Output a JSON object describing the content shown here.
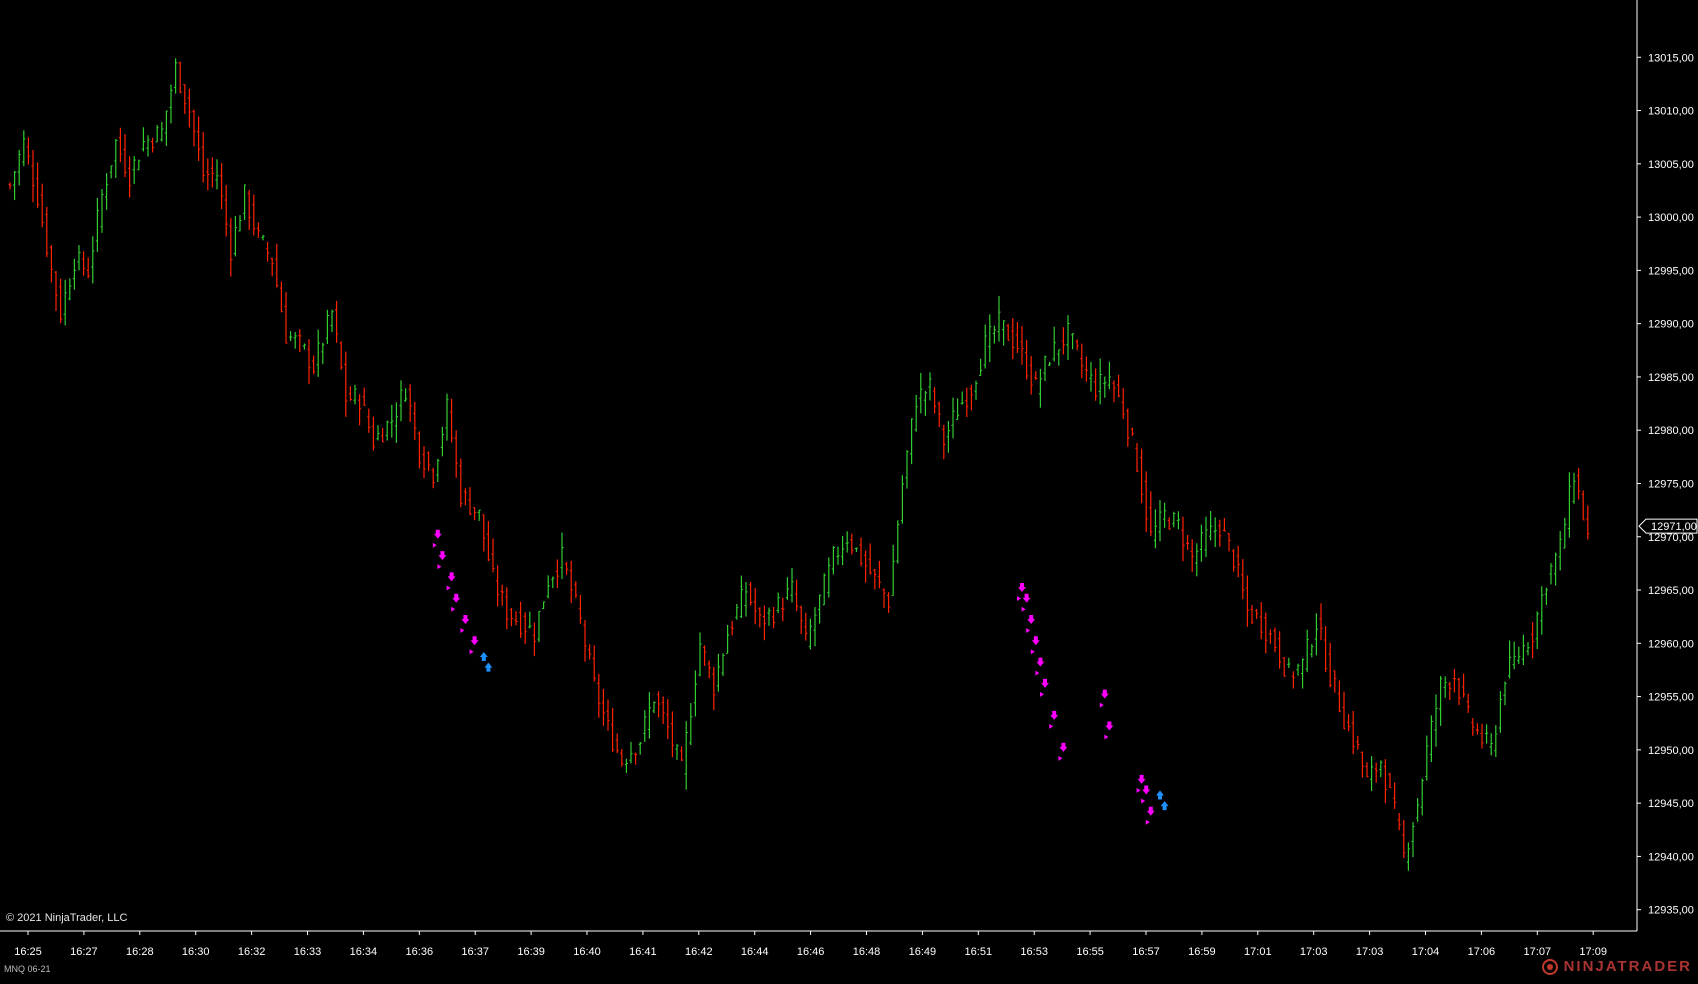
{
  "instrument": "MNQ 06-21",
  "copyright": "© 2021 NinjaTrader, LLC",
  "brand": "NINJATRADER",
  "colors": {
    "background": "#000000",
    "up": "#32cd32",
    "down": "#ff2200",
    "marker_sell": "#ff00ff",
    "marker_buy": "#1e90ff",
    "axis": "#ffffff"
  },
  "chart_data": {
    "type": "ohlc",
    "price_axis": {
      "ylim": [
        12933,
        13020
      ],
      "ticks": [
        "13015,00",
        "13010,00",
        "13005,00",
        "13000,00",
        "12995,00",
        "12990,00",
        "12985,00",
        "12980,00",
        "12975,00",
        "12970,00",
        "12965,00",
        "12960,00",
        "12955,00",
        "12950,00",
        "12945,00",
        "12940,00",
        "12935,00"
      ],
      "tick_values": [
        13015,
        13010,
        13005,
        13000,
        12995,
        12990,
        12985,
        12980,
        12975,
        12970,
        12965,
        12960,
        12955,
        12950,
        12945,
        12940,
        12935
      ],
      "last_price_label": "12971,00",
      "last_price": 12971
    },
    "time_axis": {
      "labels": [
        "16:25",
        "16:27",
        "16:28",
        "16:30",
        "16:32",
        "16:33",
        "16:34",
        "16:36",
        "16:37",
        "16:39",
        "16:40",
        "16:41",
        "16:42",
        "16:44",
        "16:46",
        "16:48",
        "16:49",
        "16:51",
        "16:53",
        "16:55",
        "16:57",
        "16:59",
        "17:01",
        "17:03",
        "17:03",
        "17:04",
        "17:06",
        "17:07",
        "17:09"
      ]
    },
    "path": [
      [
        0,
        13003
      ],
      [
        3,
        13007
      ],
      [
        6,
        13002
      ],
      [
        9,
        12995
      ],
      [
        11,
        12991
      ],
      [
        14,
        12996
      ],
      [
        17,
        12995
      ],
      [
        20,
        13002
      ],
      [
        23,
        13007
      ],
      [
        26,
        13004
      ],
      [
        29,
        13007
      ],
      [
        33,
        13008
      ],
      [
        36,
        13014
      ],
      [
        39,
        13010
      ],
      [
        42,
        13004
      ],
      [
        45,
        13004
      ],
      [
        48,
        12997
      ],
      [
        51,
        13002
      ],
      [
        54,
        12998
      ],
      [
        57,
        12996
      ],
      [
        60,
        12989
      ],
      [
        63,
        12988
      ],
      [
        66,
        12986
      ],
      [
        70,
        12991
      ],
      [
        73,
        12983
      ],
      [
        76,
        12983
      ],
      [
        79,
        12979
      ],
      [
        83,
        12981
      ],
      [
        86,
        12984
      ],
      [
        89,
        12978
      ],
      [
        92,
        12976
      ],
      [
        95,
        12982
      ],
      [
        98,
        12974
      ],
      [
        102,
        12972
      ],
      [
        105,
        12966
      ],
      [
        108,
        12963
      ],
      [
        111,
        12962
      ],
      [
        114,
        12961
      ],
      [
        117,
        12966
      ],
      [
        120,
        12968
      ],
      [
        124,
        12962
      ],
      [
        127,
        12956
      ],
      [
        130,
        12952
      ],
      [
        133,
        12949
      ],
      [
        137,
        12951
      ],
      [
        140,
        12955
      ],
      [
        143,
        12952
      ],
      [
        146,
        12948
      ],
      [
        150,
        12960
      ],
      [
        153,
        12956
      ],
      [
        156,
        12961
      ],
      [
        160,
        12965
      ],
      [
        163,
        12962
      ],
      [
        166,
        12963
      ],
      [
        170,
        12965
      ],
      [
        173,
        12960
      ],
      [
        176,
        12964
      ],
      [
        179,
        12968
      ],
      [
        182,
        12970
      ],
      [
        185,
        12968
      ],
      [
        188,
        12966
      ],
      [
        191,
        12964
      ],
      [
        194,
        12975
      ],
      [
        197,
        12983
      ],
      [
        200,
        12984
      ],
      [
        203,
        12979
      ],
      [
        206,
        12982
      ],
      [
        209,
        12984
      ],
      [
        212,
        12988
      ],
      [
        215,
        12990
      ],
      [
        219,
        12988
      ],
      [
        223,
        12984
      ],
      [
        226,
        12987
      ],
      [
        230,
        12989
      ],
      [
        233,
        12986
      ],
      [
        236,
        12984
      ],
      [
        239,
        12985
      ],
      [
        242,
        12982
      ],
      [
        245,
        12977
      ],
      [
        248,
        12970
      ],
      [
        251,
        12972
      ],
      [
        254,
        12971
      ],
      [
        257,
        12968
      ],
      [
        260,
        12970
      ],
      [
        263,
        12971
      ],
      [
        266,
        12968
      ],
      [
        269,
        12963
      ],
      [
        272,
        12962
      ],
      [
        275,
        12960
      ],
      [
        278,
        12957
      ],
      [
        281,
        12958
      ],
      [
        284,
        12962
      ],
      [
        287,
        12957
      ],
      [
        290,
        12953
      ],
      [
        293,
        12950
      ],
      [
        295,
        12947
      ],
      [
        298,
        12949
      ],
      [
        301,
        12944
      ],
      [
        303,
        12940
      ],
      [
        306,
        12945
      ],
      [
        308,
        12950
      ],
      [
        311,
        12956
      ],
      [
        314,
        12957
      ],
      [
        317,
        12953
      ],
      [
        320,
        12951
      ],
      [
        322,
        12950
      ],
      [
        325,
        12957
      ],
      [
        328,
        12959
      ],
      [
        331,
        12961
      ],
      [
        334,
        12966
      ],
      [
        337,
        12969
      ],
      [
        340,
        12976
      ],
      [
        343,
        12970
      ]
    ],
    "markers_sell": [
      [
        93,
        12970
      ],
      [
        94,
        12968
      ],
      [
        96,
        12966
      ],
      [
        97,
        12964
      ],
      [
        99,
        12962
      ],
      [
        101,
        12960
      ],
      [
        220,
        12965
      ],
      [
        221,
        12964
      ],
      [
        222,
        12962
      ],
      [
        223,
        12960
      ],
      [
        224,
        12958
      ],
      [
        225,
        12956
      ],
      [
        227,
        12953
      ],
      [
        229,
        12950
      ],
      [
        238,
        12955
      ],
      [
        239,
        12952
      ],
      [
        246,
        12947
      ],
      [
        247,
        12946
      ],
      [
        248,
        12944
      ]
    ],
    "markers_buy": [
      [
        103,
        12959
      ],
      [
        104,
        12958
      ],
      [
        250,
        12946
      ],
      [
        251,
        12945
      ]
    ]
  }
}
